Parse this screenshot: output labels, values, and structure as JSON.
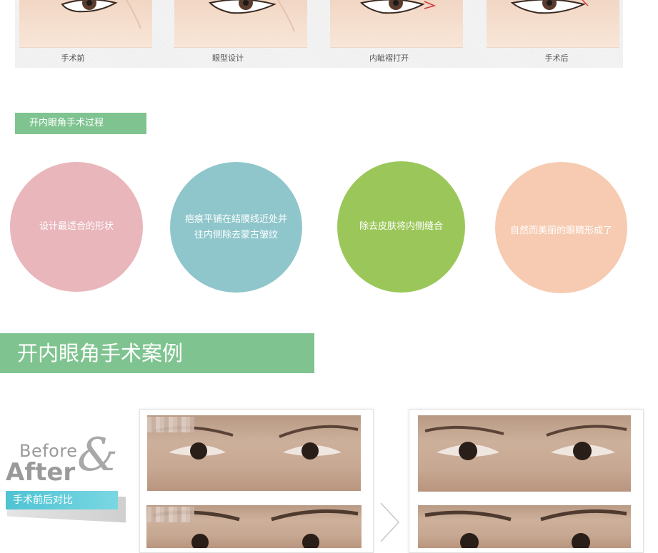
{
  "process_steps": {
    "labels": [
      "手术前",
      "眼型设计",
      "内眦褶打开",
      "手术后"
    ]
  },
  "section_process": {
    "title": "开内眼角手术过程"
  },
  "circles": [
    {
      "text": "设计最适合的形状",
      "color": "#e8b6bb"
    },
    {
      "text": "疤痕平铺在结膜线近处并往内侧除去蒙古皱纹",
      "line1": "疤痕平铺在结膜线近处并",
      "line2": "往内侧除去蒙古皱纹",
      "color": "#8ec6cb"
    },
    {
      "text": "除去皮肤将内侧缝合",
      "color": "#9bc75a"
    },
    {
      "text": "自然而美丽的眼睛形成了",
      "color": "#f6cbb1"
    }
  ],
  "section_cases": {
    "title": "开内眼角手术案例"
  },
  "before_after": {
    "word_before": "Before",
    "word_after": "After",
    "ampersand": "&",
    "tag": "手术前后对比"
  },
  "colors": {
    "accent_green": "#7fc490",
    "tag_cyan": "#4fc3d3"
  },
  "icons": {
    "next": "chevron-right-icon"
  }
}
